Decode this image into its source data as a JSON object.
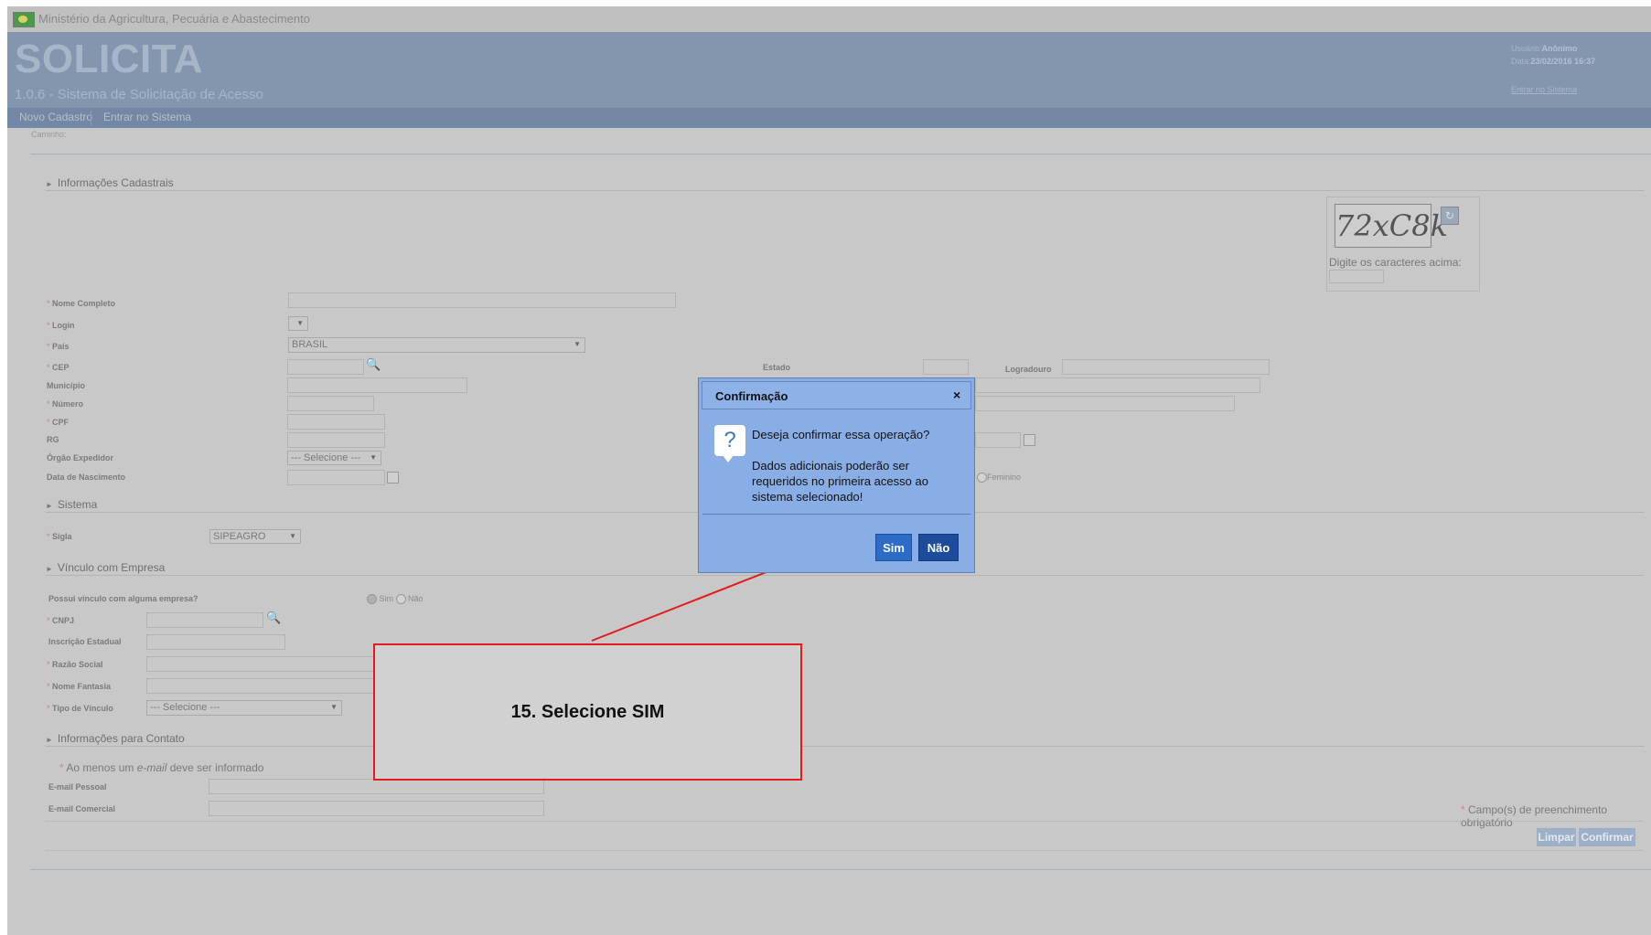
{
  "topbar": {
    "ministry": "Ministério da Agricultura, Pecuária e Abastecimento"
  },
  "header": {
    "app_title": "SOLICITA",
    "app_subtitle": "1.0.6 - Sistema de Solicitação de Acesso",
    "user_label": "Usuário:",
    "user_value": "Anônimo",
    "date_label": "Data:",
    "date_value": "23/02/2016 16:37",
    "login_link": "Entrar no Sistema"
  },
  "nav": {
    "items": [
      "Novo Cadastro",
      "Entrar no Sistema"
    ]
  },
  "breadcrumb": "Caminho:",
  "sections": {
    "cadastrais": "Informações Cadastrais",
    "sistema": "Sistema",
    "vinculo": "Vínculo com Empresa",
    "contato": "Informações para Contato"
  },
  "captcha": {
    "image_text": "72xC8k",
    "label": "Digite os caracteres acima:"
  },
  "cadastrais": {
    "nome": "Nome Completo",
    "login": "Login",
    "pais": "País",
    "pais_value": "BRASIL",
    "cep": "CEP",
    "estado": "Estado",
    "logradouro": "Logradouro",
    "municipio": "Município",
    "numero": "Número",
    "cpf": "CPF",
    "rg": "RG",
    "orgao": "Órgão Expedidor",
    "orgao_value": "--- Selecione ---",
    "nascimento": "Data de Nascimento",
    "feminino": "Feminino"
  },
  "sistema": {
    "sigla": "Sigla",
    "sigla_value": "SIPEAGRO"
  },
  "vinculo": {
    "possui": "Possui vínculo com alguma empresa?",
    "sim": "Sim",
    "nao": "Não",
    "cnpj": "CNPJ",
    "inscricao": "Inscrição Estadual",
    "razao": "Razão Social",
    "fantasia": "Nome Fantasia",
    "tipo": "Tipo de Vínculo",
    "tipo_value": "--- Selecione ---"
  },
  "contato": {
    "note_prefix": "Ao menos um ",
    "note_em": "e-mail",
    "note_suffix": " deve ser informado",
    "email_pessoal": "E-mail Pessoal",
    "email_comercial": "E-mail Comercial"
  },
  "required_note": "Campo(s) de preenchimento obrigatório",
  "required_mark": "*",
  "buttons": {
    "limpar": "Limpar",
    "confirmar": "Confirmar"
  },
  "dialog": {
    "title": "Confirmação",
    "close": "×",
    "icon": "?",
    "question": "Deseja confirmar essa operação?",
    "details": "Dados adicionais poderão ser requeridos no primeira acesso ao sistema selecionado!",
    "sim": "Sim",
    "nao": "Não"
  },
  "callout": {
    "text": "15. Selecione SIM"
  },
  "colors": {
    "annotation_red": "#e31b1b",
    "header_bg": "#8496ae",
    "dialog_bg": "#89aee6",
    "sim_button": "#2c6cc6"
  }
}
